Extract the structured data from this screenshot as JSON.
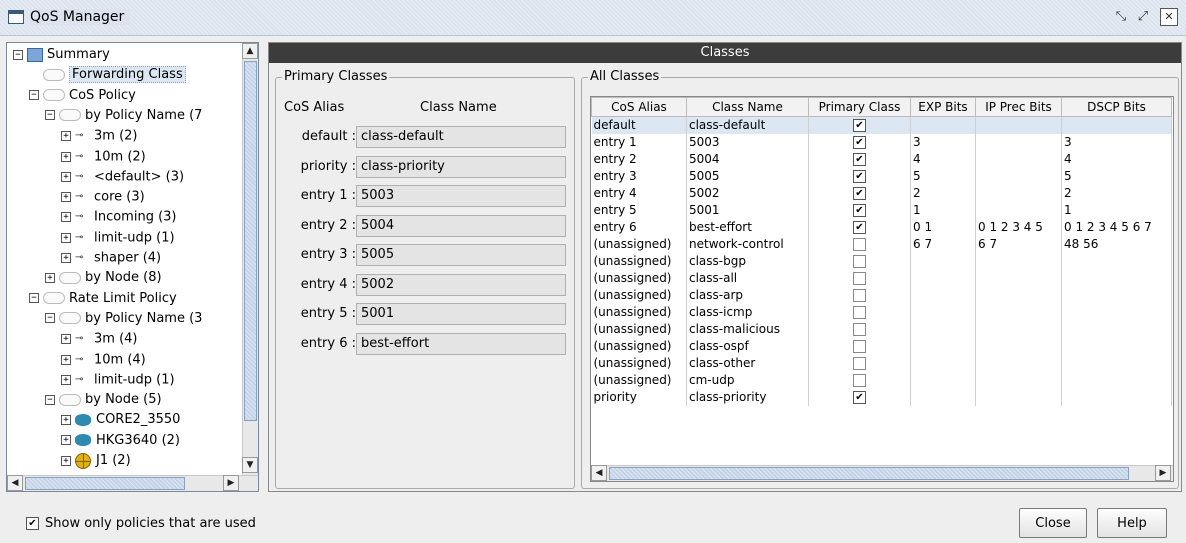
{
  "window": {
    "title": "QoS Manager",
    "controls": {
      "min": "⤡",
      "max": "⤢",
      "close": "✕"
    }
  },
  "tree": {
    "items": [
      {
        "label": "Summary",
        "icon": "summary-icon",
        "expander": "−"
      },
      {
        "label": "Forwarding Class",
        "icon": "folder-icon",
        "expander": "",
        "selected": true
      },
      {
        "label": "CoS Policy",
        "icon": "folder-icon",
        "expander": "−"
      },
      {
        "label": "by Policy Name (7",
        "icon": "folder-icon",
        "expander": "−"
      },
      {
        "label": "3m (2)",
        "icon": "key-icon",
        "expander": "+"
      },
      {
        "label": "10m (2)",
        "icon": "key-icon",
        "expander": "+"
      },
      {
        "label": "<default> (3)",
        "icon": "key-icon",
        "expander": "+"
      },
      {
        "label": "core (3)",
        "icon": "key-icon",
        "expander": "+"
      },
      {
        "label": "Incoming (3)",
        "icon": "key-icon",
        "expander": "+"
      },
      {
        "label": "limit-udp (1)",
        "icon": "key-icon",
        "expander": "+"
      },
      {
        "label": "shaper (4)",
        "icon": "key-icon",
        "expander": "+"
      },
      {
        "label": "by Node (8)",
        "icon": "folder-icon",
        "expander": "+"
      },
      {
        "label": "Rate Limit Policy",
        "icon": "folder-icon",
        "expander": "−"
      },
      {
        "label": "by Policy Name (3",
        "icon": "folder-icon",
        "expander": "−"
      },
      {
        "label": "3m (4)",
        "icon": "key-icon",
        "expander": "+"
      },
      {
        "label": "10m (4)",
        "icon": "key-icon",
        "expander": "+"
      },
      {
        "label": "limit-udp (1)",
        "icon": "key-icon",
        "expander": "+"
      },
      {
        "label": "by Node (5)",
        "icon": "folder-icon",
        "expander": "−"
      },
      {
        "label": "CORE2_3550",
        "icon": "router-icon",
        "expander": "+"
      },
      {
        "label": "HKG3640 (2)",
        "icon": "router-icon",
        "expander": "+"
      },
      {
        "label": "J1 (2)",
        "icon": "juniper-icon",
        "expander": "+"
      }
    ]
  },
  "classes": {
    "header": "Classes",
    "primary": {
      "legend": "Primary Classes",
      "col_alias": "CoS Alias",
      "col_name": "Class Name",
      "rows": [
        {
          "alias": "default :",
          "value": "class-default"
        },
        {
          "alias": "priority :",
          "value": "class-priority"
        },
        {
          "alias": "entry 1 :",
          "value": "5003"
        },
        {
          "alias": "entry 2 :",
          "value": "5004"
        },
        {
          "alias": "entry 3 :",
          "value": "5005"
        },
        {
          "alias": "entry 4 :",
          "value": "5002"
        },
        {
          "alias": "entry 5 :",
          "value": "5001"
        },
        {
          "alias": "entry 6 :",
          "value": "best-effort"
        }
      ]
    },
    "all": {
      "legend": "All Classes",
      "columns": [
        "CoS Alias",
        "Class Name",
        "Primary Class",
        "EXP Bits",
        "IP Prec Bits",
        "DSCP Bits"
      ],
      "rows": [
        [
          "default",
          "class-default",
          true,
          "",
          "",
          ""
        ],
        [
          "entry 1",
          "5003",
          true,
          "3",
          "",
          "3"
        ],
        [
          "entry 2",
          "5004",
          true,
          "4",
          "",
          "4"
        ],
        [
          "entry 3",
          "5005",
          true,
          "5",
          "",
          "5"
        ],
        [
          "entry 4",
          "5002",
          true,
          "2",
          "",
          "2"
        ],
        [
          "entry 5",
          "5001",
          true,
          "1",
          "",
          "1"
        ],
        [
          "entry 6",
          "best-effort",
          true,
          "0 1",
          "0 1 2 3 4 5",
          "0 1 2 3 4 5 6 7"
        ],
        [
          "(unassigned)",
          "network-control",
          false,
          "6 7",
          "6 7",
          "48 56"
        ],
        [
          "(unassigned)",
          "class-bgp",
          false,
          "",
          "",
          ""
        ],
        [
          "(unassigned)",
          "class-all",
          false,
          "",
          "",
          ""
        ],
        [
          "(unassigned)",
          "class-arp",
          false,
          "",
          "",
          ""
        ],
        [
          "(unassigned)",
          "class-icmp",
          false,
          "",
          "",
          ""
        ],
        [
          "(unassigned)",
          "class-malicious",
          false,
          "",
          "",
          ""
        ],
        [
          "(unassigned)",
          "class-ospf",
          false,
          "",
          "",
          ""
        ],
        [
          "(unassigned)",
          "class-other",
          false,
          "",
          "",
          ""
        ],
        [
          "(unassigned)",
          "cm-udp",
          false,
          "",
          "",
          ""
        ],
        [
          "priority",
          "class-priority",
          true,
          "",
          "",
          ""
        ]
      ]
    }
  },
  "footer": {
    "show_used_label": "Show only policies that are used",
    "show_used_checked": true,
    "close_label": "Close",
    "help_label": "Help"
  },
  "colors": {
    "header_bg": "#3c3c3c",
    "selection": "#dce7f3",
    "titlebar": "#dbe4ee"
  }
}
